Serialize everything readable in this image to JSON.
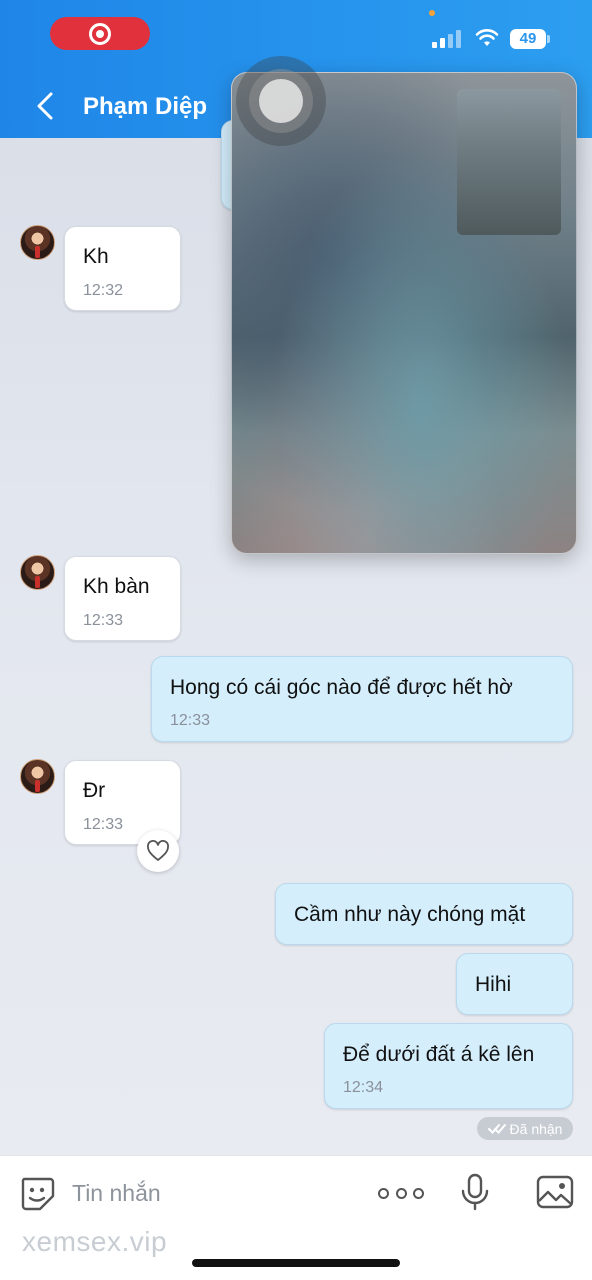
{
  "status_bar": {
    "battery": "49"
  },
  "header": {
    "contact_name": "Phạm Diệp",
    "bg_color": "#2196f0"
  },
  "messages": [
    {
      "direction": "in",
      "text": "Kh",
      "time": "12:32"
    },
    {
      "direction": "in",
      "text": "Kh bàn",
      "time": "12:33"
    },
    {
      "direction": "out",
      "text": "Hong có cái góc nào để được hết hờ",
      "time": "12:33"
    },
    {
      "direction": "in",
      "text": "Đr",
      "time": "12:33",
      "reaction_icon": "heart-icon"
    },
    {
      "direction": "out",
      "text": "Cầm như này chóng mặt",
      "time": ""
    },
    {
      "direction": "out",
      "text": "Hihi",
      "time": ""
    },
    {
      "direction": "out",
      "text": "Để dưới đất á kê lên",
      "time": "12:34"
    }
  ],
  "delivery_status": "Đã nhận",
  "input": {
    "placeholder": "Tin nhắn"
  },
  "watermark": "xemsex.vip",
  "colors": {
    "incoming_bubble": "#ffffff",
    "outgoing_bubble": "#d4eefc",
    "recording_pill": "#e0313c"
  }
}
